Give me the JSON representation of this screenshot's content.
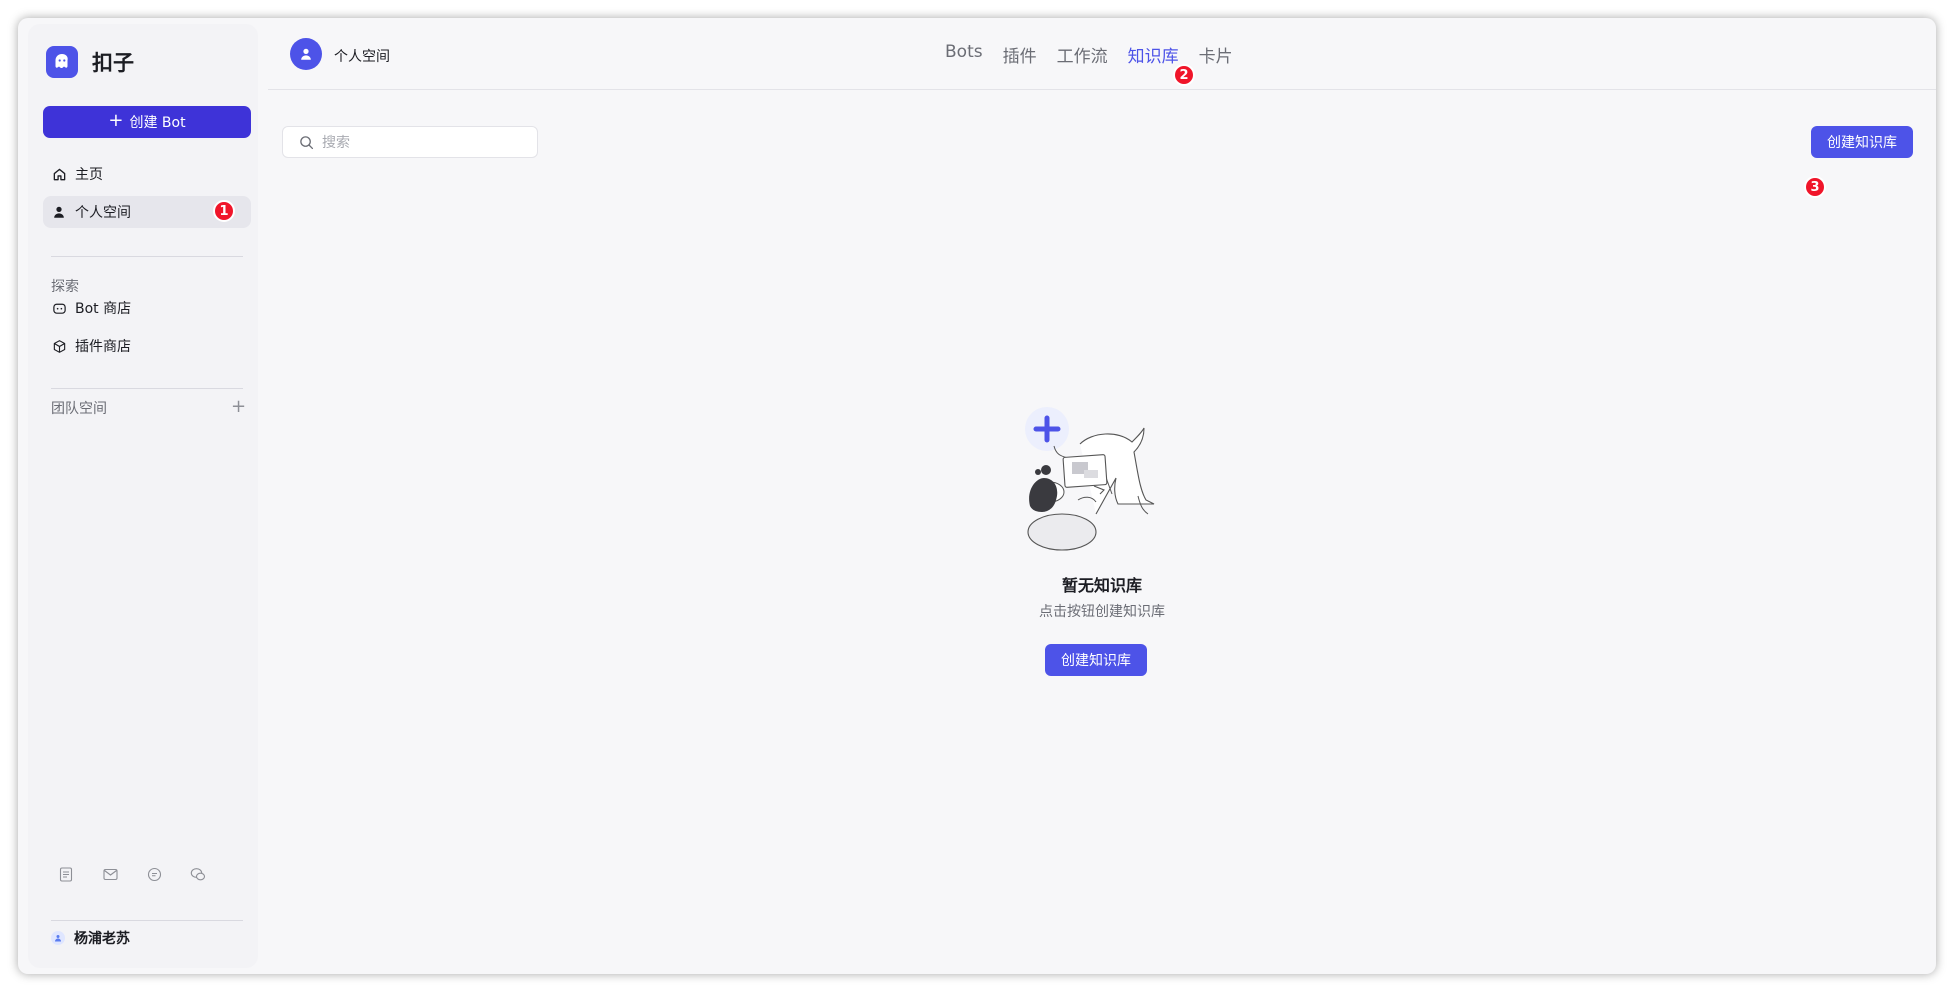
{
  "app": {
    "name": "扣子"
  },
  "sidebar": {
    "create_bot_label": "创建 Bot",
    "nav": [
      {
        "label": "主页",
        "icon": "home-icon"
      },
      {
        "label": "个人空间",
        "icon": "user-icon",
        "active": true
      }
    ],
    "explore_label": "探索",
    "explore_items": [
      {
        "label": "Bot 商店",
        "icon": "bot-icon"
      },
      {
        "label": "插件商店",
        "icon": "cube-icon"
      }
    ],
    "team_label": "团队空间",
    "footer_icons": [
      "document-icon",
      "mail-icon",
      "chat-icon",
      "wechat-icon"
    ],
    "user_name": "杨浦老苏"
  },
  "header": {
    "space_name": "个人空间",
    "tabs": [
      {
        "label": "Bots"
      },
      {
        "label": "插件"
      },
      {
        "label": "工作流"
      },
      {
        "label": "知识库",
        "active": true
      },
      {
        "label": "卡片"
      }
    ]
  },
  "main": {
    "search_placeholder": "搜索",
    "create_kb_label": "创建知识库",
    "empty_title": "暂无知识库",
    "empty_subtitle": "点击按钮创建知识库",
    "empty_button_label": "创建知识库"
  },
  "annotations": [
    "1",
    "2",
    "3"
  ],
  "colors": {
    "brand": "#4d53e8",
    "create_bot": "#3e33d8",
    "annotation_badge": "#f0152a"
  }
}
